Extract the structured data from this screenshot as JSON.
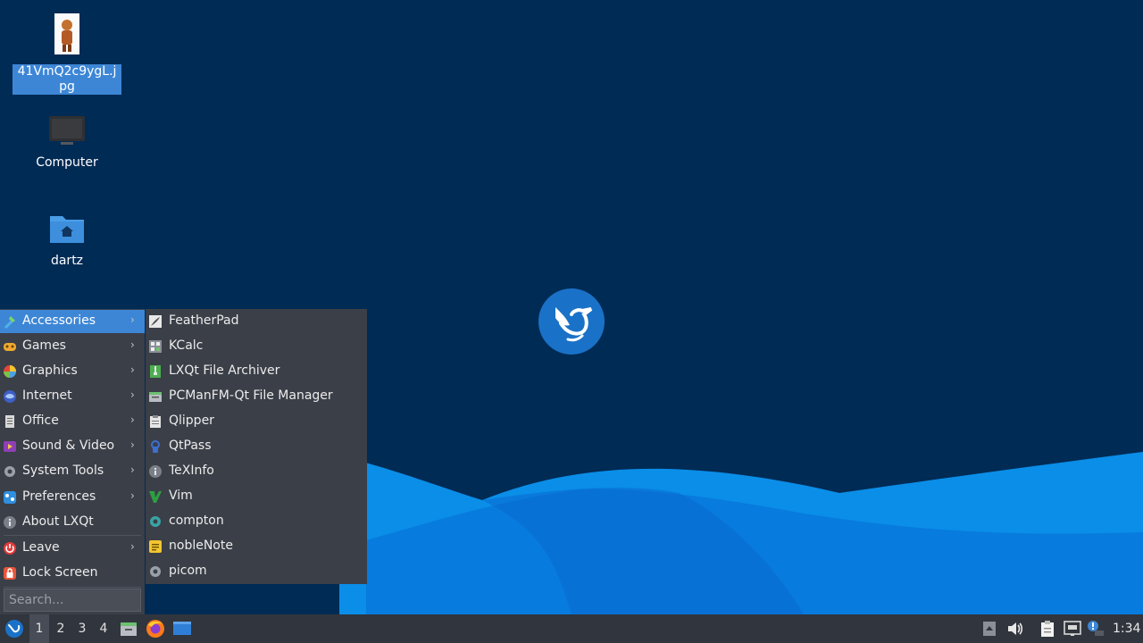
{
  "desktop": {
    "icons": [
      {
        "label": "41VmQ2c9ygL.jpg",
        "icon": "image-file-icon"
      },
      {
        "label": "Computer",
        "icon": "computer-icon"
      },
      {
        "label": "dartz",
        "icon": "home-folder-icon"
      }
    ],
    "logo": "lxqt-hummingbird-logo"
  },
  "menu": {
    "categories": [
      {
        "label": "Accessories",
        "icon": "accessories-icon",
        "submenu": true,
        "active": true
      },
      {
        "label": "Games",
        "icon": "games-icon",
        "submenu": true
      },
      {
        "label": "Graphics",
        "icon": "graphics-icon",
        "submenu": true
      },
      {
        "label": "Internet",
        "icon": "internet-icon",
        "submenu": true
      },
      {
        "label": "Office",
        "icon": "office-icon",
        "submenu": true
      },
      {
        "label": "Sound & Video",
        "icon": "sound-video-icon",
        "submenu": true
      },
      {
        "label": "System Tools",
        "icon": "system-tools-icon",
        "submenu": true
      },
      {
        "label": "Preferences",
        "icon": "preferences-icon",
        "submenu": true
      },
      {
        "label": "About LXQt",
        "icon": "info-icon",
        "submenu": false
      },
      {
        "label": "Leave",
        "icon": "power-icon",
        "submenu": true
      },
      {
        "label": "Lock Screen",
        "icon": "lock-icon",
        "submenu": false
      }
    ],
    "search_placeholder": "Search..."
  },
  "submenu": {
    "items": [
      {
        "label": "FeatherPad",
        "icon": "featherpad-icon"
      },
      {
        "label": "KCalc",
        "icon": "calculator-icon"
      },
      {
        "label": "LXQt File Archiver",
        "icon": "archive-icon"
      },
      {
        "label": "PCManFM-Qt File Manager",
        "icon": "file-manager-icon"
      },
      {
        "label": "Qlipper",
        "icon": "clipboard-icon"
      },
      {
        "label": "QtPass",
        "icon": "password-icon"
      },
      {
        "label": "TeXInfo",
        "icon": "info-icon"
      },
      {
        "label": "Vim",
        "icon": "vim-icon"
      },
      {
        "label": "compton",
        "icon": "gear-icon"
      },
      {
        "label": "nobleNote",
        "icon": "note-icon"
      },
      {
        "label": "picom",
        "icon": "gear-icon"
      }
    ]
  },
  "taskbar": {
    "workspaces": [
      "1",
      "2",
      "3",
      "4"
    ],
    "active_workspace": "1",
    "launchers": [
      "file-manager-icon",
      "firefox-icon",
      "desktop-icon"
    ],
    "tray": [
      "tray-arrow-icon",
      "volume-icon",
      "clipboard-icon",
      "network-icon",
      "update-notifier-icon"
    ],
    "clock": "1:34"
  },
  "colors": {
    "desktop_bg": "#002b55",
    "wave_light": "#0a8ee8",
    "wave_dark": "#0a6ad0",
    "menu_bg": "#3b3f48",
    "highlight": "#3d86d6",
    "taskbar_bg": "#31353d"
  }
}
